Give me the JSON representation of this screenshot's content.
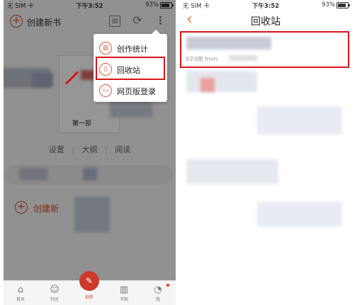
{
  "left_screen": {
    "status_bar": {
      "carrier": "无 SIM 卡",
      "time": "下午3:52",
      "battery": "93%"
    },
    "top_bar": {
      "create_new_book": "创建新书"
    },
    "menu": {
      "items": [
        {
          "label": "创作统计",
          "icon": "bar-chart-icon"
        },
        {
          "label": "回收站",
          "icon": "trash-icon"
        },
        {
          "label": "网页版登录",
          "icon": "monitor-icon"
        }
      ]
    },
    "book": {
      "title_partial": "第一部"
    },
    "book_links": {
      "settings": "设置",
      "outline": "大纲",
      "read": "阅读"
    },
    "create_new_bottom": "创建新",
    "tab_bar": {
      "tabs": [
        {
          "label": "首页",
          "icon": "home-icon"
        },
        {
          "label": "社区",
          "icon": "community-icon"
        },
        {
          "label": "创作",
          "icon": "pen-icon"
        },
        {
          "label": "书架",
          "icon": "bookshelf-icon"
        },
        {
          "label": "我",
          "icon": "profile-icon"
        }
      ]
    }
  },
  "right_screen": {
    "status_bar": {
      "carrier": "无 SIM 卡",
      "time": "下午3:52",
      "battery": "93%"
    },
    "nav": {
      "title": "回收站"
    },
    "item": {
      "meta": "8字0图 from:"
    }
  },
  "colors": {
    "accent": "#cc3a2a",
    "highlight": "#d9141b",
    "back_arrow": "#e07a3a"
  }
}
